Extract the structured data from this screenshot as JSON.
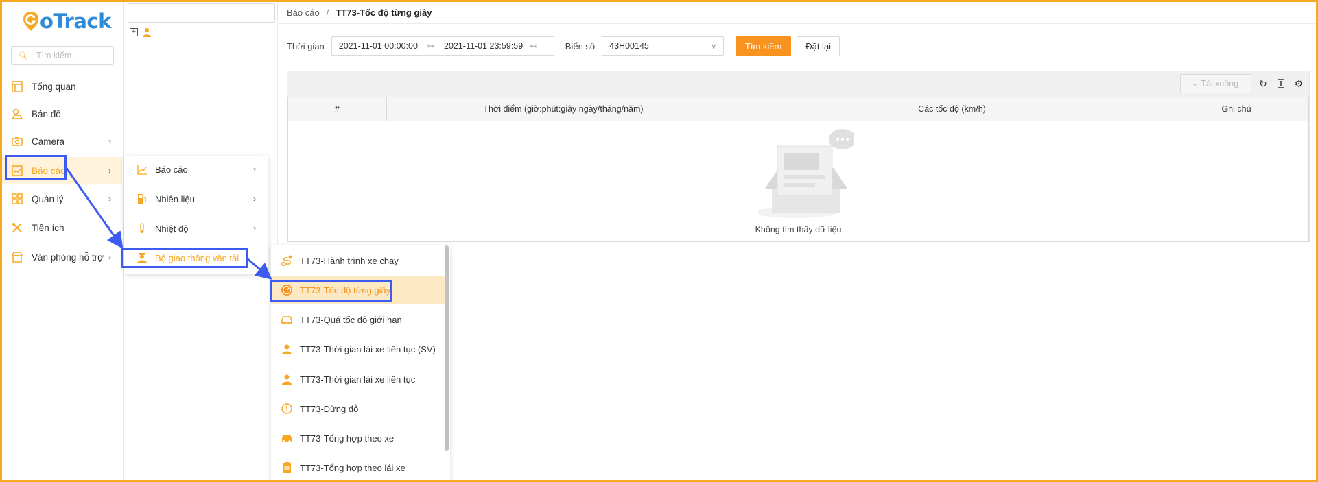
{
  "brand": {
    "logo_g": "G",
    "logo_rest": "oTrack"
  },
  "sidebar": {
    "search_placeholder": "Tìm kiếm...",
    "items": [
      {
        "label": "Tổng quan",
        "icon": "dashboard-icon",
        "has_chevron": false
      },
      {
        "label": "Bản đồ",
        "icon": "map-icon",
        "has_chevron": false
      },
      {
        "label": "Camera",
        "icon": "camera-icon",
        "has_chevron": true
      },
      {
        "label": "Báo cáo",
        "icon": "chart-icon",
        "has_chevron": true,
        "active": true
      },
      {
        "label": "Quản lý",
        "icon": "grid-icon",
        "has_chevron": true
      },
      {
        "label": "Tiện ích",
        "icon": "tools-icon",
        "has_chevron": true
      },
      {
        "label": "Văn phòng hỗ trợ",
        "icon": "store-icon",
        "has_chevron": true
      }
    ]
  },
  "breadcrumb": {
    "parent": "Báo cáo",
    "separator": "/",
    "current": "TT73-Tốc độ từng giây"
  },
  "filters": {
    "time_label": "Thời gian",
    "start": "2021-11-01 00:00:00",
    "end": "2021-11-01 23:59:59",
    "plate_label": "Biển số",
    "plate_value": "43H00145",
    "search_button": "Tìm kiếm",
    "reset_button": "Đặt lại"
  },
  "table": {
    "download_label": "Tải xuống",
    "columns": [
      "#",
      "Thời điểm (giờ:phút:giây ngày/tháng/năm)",
      "Các tốc độ (km/h)",
      "Ghi chú"
    ],
    "rows": [],
    "empty_text": "Không tìm thấy dữ liệu"
  },
  "flyout_reports": {
    "items": [
      {
        "label": "Báo cáo",
        "icon": "line-chart-icon"
      },
      {
        "label": "Nhiên liệu",
        "icon": "fuel-icon"
      },
      {
        "label": "Nhiệt độ",
        "icon": "thermometer-icon"
      },
      {
        "label": "Bộ giao thông vận tải",
        "icon": "officer-icon",
        "active": true
      }
    ]
  },
  "flyout_tt73": {
    "items": [
      {
        "label": "TT73-Hành trình xe chạy",
        "icon": "route-icon"
      },
      {
        "label": "TT73-Tốc độ từng giây",
        "icon": "speedometer-icon",
        "active": true
      },
      {
        "label": "TT73-Quá tốc độ giới hạn",
        "icon": "car-speed-icon"
      },
      {
        "label": "TT73-Thời gian lái xe liên tục (SV)",
        "icon": "driver-icon"
      },
      {
        "label": "TT73-Thời gian lái xe liên tục",
        "icon": "driver-icon"
      },
      {
        "label": "TT73-Dừng đỗ",
        "icon": "alert-icon"
      },
      {
        "label": "TT73-Tổng hợp theo xe",
        "icon": "car-icon"
      },
      {
        "label": "TT73-Tổng hợp theo lái xe",
        "icon": "clipboard-icon"
      }
    ]
  },
  "colors": {
    "accent": "#f7a823",
    "primary_button": "#f7931e",
    "annotation": "#3d5af1",
    "logo_blue": "#2f8ad8"
  }
}
